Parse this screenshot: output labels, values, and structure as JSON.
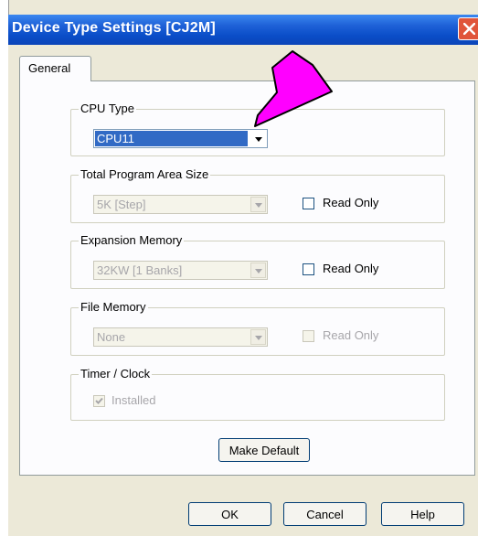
{
  "window": {
    "title": "Device Type Settings [CJ2M]"
  },
  "tabs": [
    {
      "label": "General"
    }
  ],
  "groups": {
    "cpu_type": {
      "label": "CPU Type",
      "value": "CPU11"
    },
    "program_area": {
      "label": "Total Program Area Size",
      "value": "5K [Step]",
      "checkbox_label": "Read Only"
    },
    "expansion_memory": {
      "label": "Expansion Memory",
      "value": "32KW [1 Banks]",
      "checkbox_label": "Read Only"
    },
    "file_memory": {
      "label": "File Memory",
      "value": "None",
      "checkbox_label": "Read Only"
    },
    "timer_clock": {
      "label": "Timer / Clock",
      "checkbox_label": "Installed"
    }
  },
  "buttons": {
    "make_default": "Make Default",
    "ok": "OK",
    "cancel": "Cancel",
    "help": "Help"
  },
  "annotation": {
    "arrow_color": "#ff00ff",
    "icon": "pointer-arrow-icon"
  },
  "colors": {
    "titlebar": "#0a4dc8",
    "selection": "#316ac5",
    "close": "#e0553a"
  }
}
